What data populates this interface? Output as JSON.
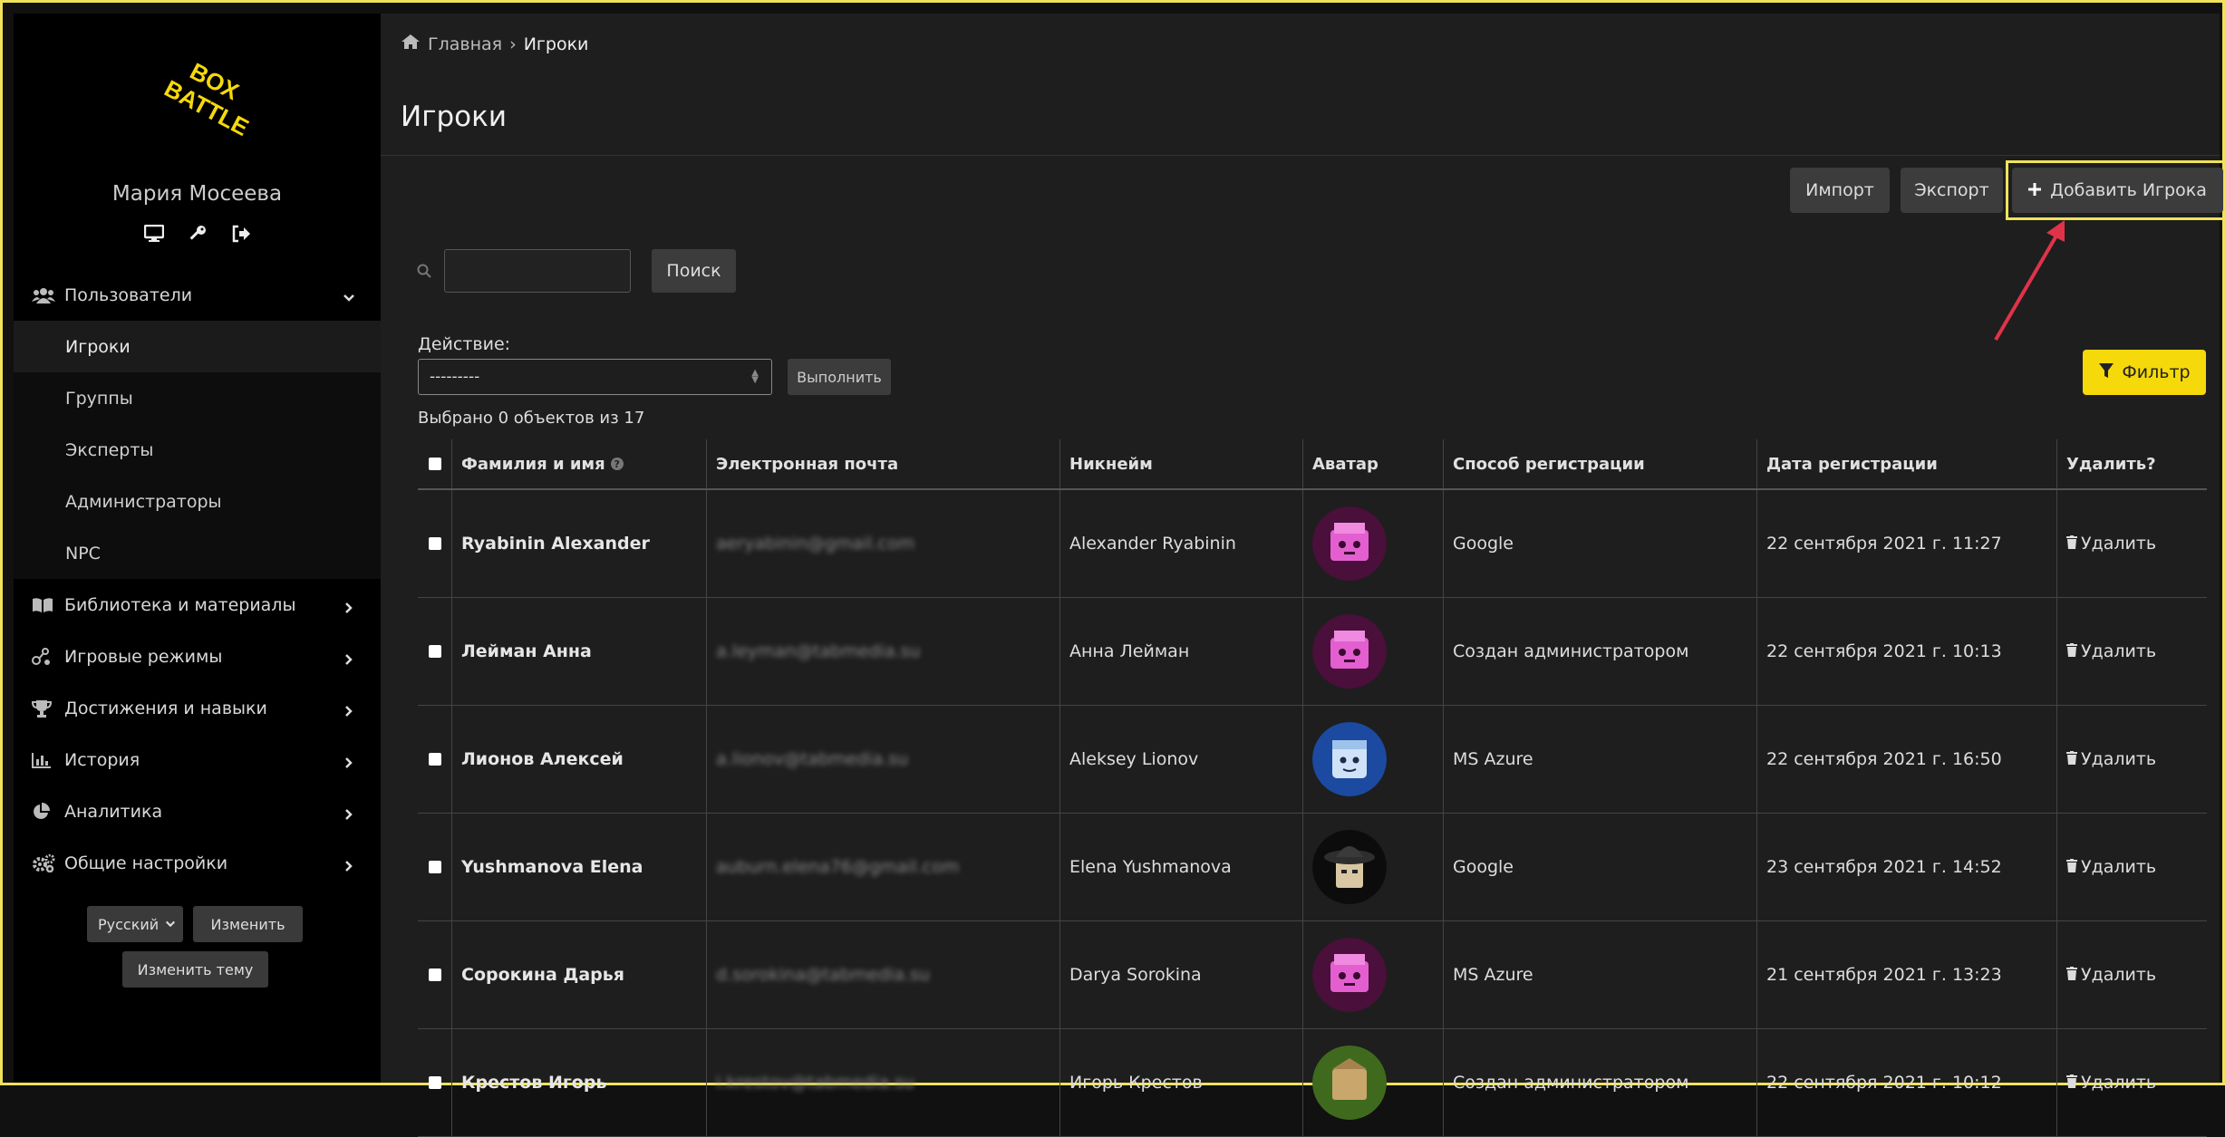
{
  "sidebar": {
    "logo_text": "BOX BATTLE",
    "user_name": "Мария Мосеева",
    "user_icons": [
      "monitor-icon",
      "key-icon",
      "logout-icon"
    ],
    "nav": [
      {
        "label": "Пользователи",
        "icon": "users-icon",
        "expanded": true,
        "children": [
          {
            "label": "Игроки",
            "active": true
          },
          {
            "label": "Группы"
          },
          {
            "label": "Эксперты"
          },
          {
            "label": "Администраторы"
          },
          {
            "label": "NPC"
          }
        ]
      },
      {
        "label": "Библиотека и материалы",
        "icon": "book-icon"
      },
      {
        "label": "Игровые режимы",
        "icon": "gamepad-icon"
      },
      {
        "label": "Достижения и навыки",
        "icon": "trophy-icon"
      },
      {
        "label": "История",
        "icon": "chart-icon"
      },
      {
        "label": "Аналитика",
        "icon": "pie-icon"
      },
      {
        "label": "Общие настройки",
        "icon": "gears-icon"
      }
    ],
    "language": "Русский",
    "change_label": "Изменить",
    "change_theme_label": "Изменить тему"
  },
  "breadcrumb": {
    "home": "Главная",
    "separator": "›",
    "current": "Игроки"
  },
  "page_title": "Игроки",
  "toolbar": {
    "import": "Импорт",
    "export": "Экспорт",
    "add_player": "Добавить Игрока"
  },
  "search": {
    "value": "",
    "button": "Поиск"
  },
  "action": {
    "label": "Действие:",
    "selected": "---------",
    "run": "Выполнить"
  },
  "filter": {
    "label": "Фильтр"
  },
  "selection_status": "Выбрано 0 объектов из 17",
  "table": {
    "headers": [
      "Фамилия и имя",
      "Электронная почта",
      "Никнейм",
      "Аватар",
      "Способ регистрации",
      "Дата регистрации",
      "Удалить?"
    ],
    "rows": [
      {
        "name": "Ryabinin Alexander",
        "email": "aeryabinin@gmail.com",
        "nickname": "Alexander Ryabinin",
        "avatar": "pink-box",
        "method": "Google",
        "date": "22 сентября 2021 г. 11:27",
        "delete": "Удалить"
      },
      {
        "name": "Лейман Анна",
        "email": "a.leyman@tabmedia.su",
        "nickname": "Анна Лейман",
        "avatar": "pink-box",
        "method": "Создан администратором",
        "date": "22 сентября 2021 г. 10:13",
        "delete": "Удалить"
      },
      {
        "name": "Лионов Алексей",
        "email": "a.lionov@tabmedia.su",
        "nickname": "Aleksey Lionov",
        "avatar": "blue-box",
        "method": "MS Azure",
        "date": "22 сентября 2021 г. 16:50",
        "delete": "Удалить"
      },
      {
        "name": "Yushmanova Elena",
        "email": "auburn.elena76@gmail.com",
        "nickname": "Elena Yushmanova",
        "avatar": "detective-box",
        "method": "Google",
        "date": "23 сентября 2021 г. 14:52",
        "delete": "Удалить"
      },
      {
        "name": "Сорокина Дарья",
        "email": "d.sorokina@tabmedia.su",
        "nickname": "Darya Sorokina",
        "avatar": "pink-box",
        "method": "MS Azure",
        "date": "21 сентября 2021 г. 13:23",
        "delete": "Удалить"
      },
      {
        "name": "Крестов Игорь",
        "email": "i.krestov@tabmedia.su",
        "nickname": "Игорь Крестов",
        "avatar": "green-box",
        "method": "Создан администратором",
        "date": "22 сентября 2021 г. 10:12",
        "delete": "Удалить"
      }
    ]
  },
  "colors": {
    "accent": "#f5d90a",
    "highlight": "#f0e25a",
    "arrow": "#e0334a",
    "sidebar_bg": "#000000",
    "main_bg": "#1e1e1e"
  }
}
